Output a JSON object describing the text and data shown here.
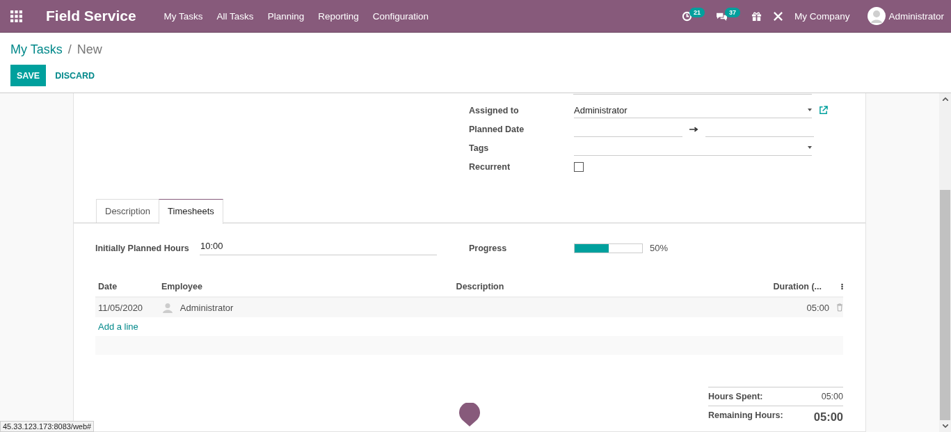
{
  "navbar": {
    "app_name": "Field Service",
    "menu": [
      "My Tasks",
      "All Tasks",
      "Planning",
      "Reporting",
      "Configuration"
    ],
    "activity_count": "21",
    "message_count": "37",
    "company": "My Company",
    "user": "Administrator"
  },
  "breadcrumb": {
    "parent": "My Tasks",
    "separator": "/",
    "current": "New"
  },
  "buttons": {
    "save": "SAVE",
    "discard": "DISCARD"
  },
  "fields": [
    {
      "kind": "select",
      "label": "Assigned to",
      "value": "Administrator",
      "external_link": true
    },
    {
      "kind": "daterange",
      "label": "Planned Date"
    },
    {
      "kind": "select",
      "label": "Tags",
      "external_link": false
    },
    {
      "kind": "checkbox",
      "label": "Recurrent",
      "checked": false
    }
  ],
  "tabs": [
    {
      "label": "Description",
      "selected": false
    },
    {
      "label": "Timesheets",
      "selected": true
    }
  ],
  "planned_hours": {
    "label": "Initially Planned Hours",
    "value": "10:00"
  },
  "progress": {
    "label": "Progress",
    "level": 0.5,
    "reading": "50%"
  },
  "timesheet": {
    "columns": [
      "Date",
      "Employee",
      "Description",
      "Duration (..."
    ],
    "rows": [
      {
        "date": "11/05/2020",
        "employee": "Administrator",
        "duration": "05:00"
      }
    ],
    "add_line": "Add a line"
  },
  "totals": {
    "spent_label": "Hours Spent:",
    "spent": "05:00",
    "remaining_label": "Remaining Hours:",
    "remaining": "05:00"
  },
  "status_url": "45.33.123.173:8083/web#"
}
